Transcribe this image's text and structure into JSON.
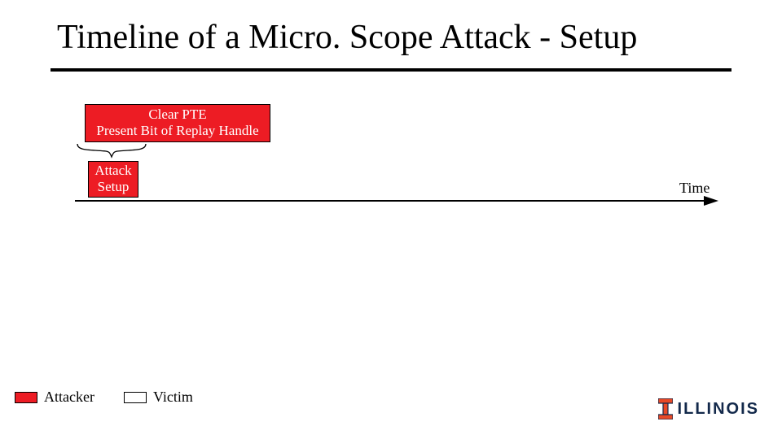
{
  "title": "Timeline of a Micro. Scope Attack - Setup",
  "callout": {
    "line1": "Clear PTE",
    "line2": "Present Bit of Replay Handle"
  },
  "phase": {
    "line1": "Attack",
    "line2": "Setup"
  },
  "axis_label": "Time",
  "legend": {
    "attacker": "Attacker",
    "victim": "Victim"
  },
  "logo_text": "ILLINOIS",
  "colors": {
    "attacker": "#ed1c24",
    "victim": "#ffffff",
    "illinois_blue": "#13294B",
    "illinois_orange": "#E84A27"
  }
}
